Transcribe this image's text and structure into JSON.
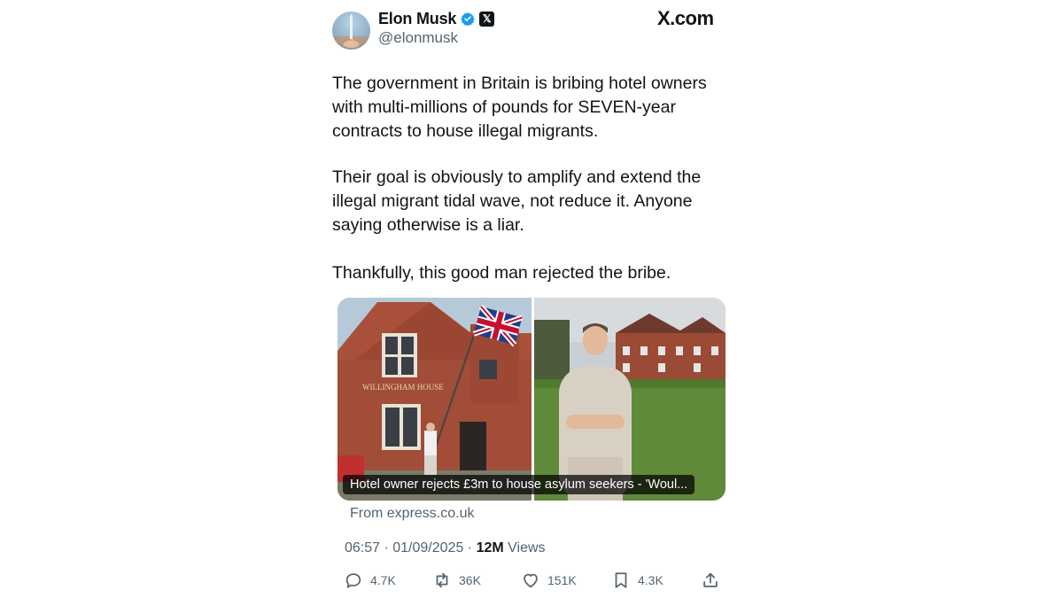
{
  "author": {
    "name": "Elon Musk",
    "handle": "@elonmusk",
    "avatar_icon": "rocket-launch-avatar",
    "verified_icon": "verified-badge-icon",
    "affiliate_icon": "x-logo-badge-icon",
    "verified_color": "#1d9bf0"
  },
  "brand": "X.com",
  "tweet": {
    "paragraph_1": "The government in Britain is bribing hotel owners with multi-millions of pounds for SEVEN-year contracts to house illegal migrants.",
    "paragraph_2": "Their goal is obviously to amplify and extend the illegal migrant tidal wave, not reduce it. Anyone saying otherwise is a liar.",
    "paragraph_3": "Thankfully, this good man rejected the bribe."
  },
  "link_card": {
    "caption": "Hotel owner rejects £3m to house asylum seekers - 'Woul...",
    "building_sign": "WILLINGHAM HOUSE",
    "source": "From express.co.uk"
  },
  "meta": {
    "timestamp": "06:57 · 01/09/2025 · ",
    "views_count": "12M",
    "views_label": " Views"
  },
  "actions": {
    "reply_count": "4.7K",
    "repost_count": "36K",
    "like_count": "151K",
    "bookmark_count": "4.3K",
    "icon_color": "#536471"
  }
}
